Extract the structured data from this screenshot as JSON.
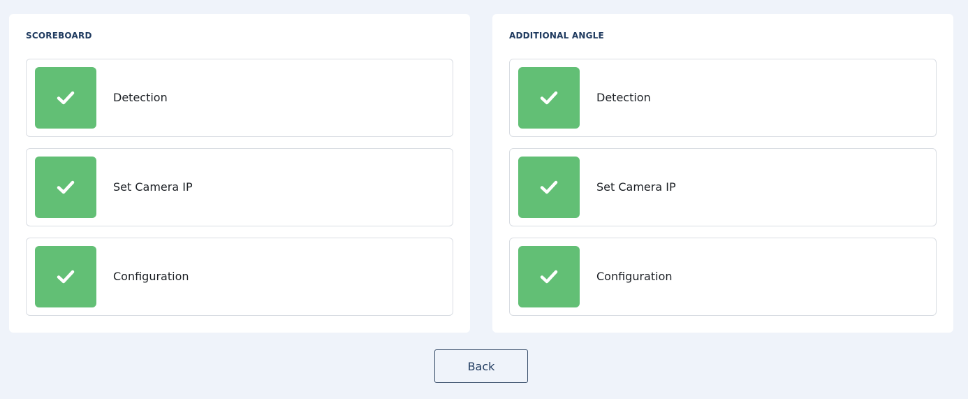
{
  "panels": [
    {
      "title": "SCOREBOARD",
      "steps": [
        {
          "label": "Detection",
          "status": "complete",
          "icon": "check-icon"
        },
        {
          "label": "Set Camera IP",
          "status": "complete",
          "icon": "check-icon"
        },
        {
          "label": "Configuration",
          "status": "complete",
          "icon": "check-icon"
        }
      ]
    },
    {
      "title": "ADDITIONAL ANGLE",
      "steps": [
        {
          "label": "Detection",
          "status": "complete",
          "icon": "check-icon"
        },
        {
          "label": "Set Camera IP",
          "status": "complete",
          "icon": "check-icon"
        },
        {
          "label": "Configuration",
          "status": "complete",
          "icon": "check-icon"
        }
      ]
    }
  ],
  "footer": {
    "back_label": "Back"
  },
  "colors": {
    "background": "#eff3fa",
    "success": "#62bf75",
    "title": "#1f3a5f"
  }
}
